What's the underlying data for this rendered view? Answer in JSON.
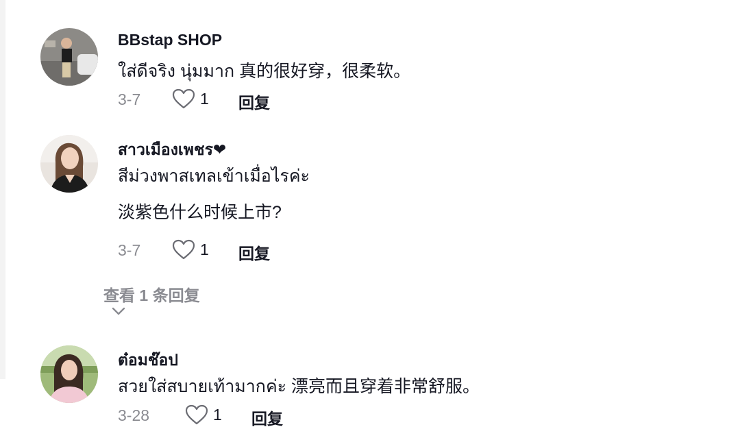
{
  "comments": [
    {
      "username": "BBstap SHOP",
      "lines": [
        "ใส่ดีจริง นุ่มมาก 真的很好穿，很柔软。"
      ],
      "date": "3-7",
      "likes": "1",
      "reply_label": "回复"
    },
    {
      "username": "สาวเมืองเพชร❤",
      "lines": [
        "สีม่วงพาสเทลเข้าเมื่อไรค่ะ",
        "淡紫色什么时候上市?"
      ],
      "date": "3-7",
      "likes": "1",
      "reply_label": "回复",
      "view_replies": "查看 1 条回复"
    },
    {
      "username": "ต๋อมช๊อป",
      "lines": [
        "สวยใส่สบายเท้ามากค่ะ 漂亮而且穿着非常舒服。"
      ],
      "date": "3-28",
      "likes": "1",
      "reply_label": "回复"
    }
  ],
  "colors": {
    "text_primary": "#161823",
    "text_secondary": "#8a8b91",
    "background": "#ffffff"
  },
  "icons": {
    "like": "heart-outline-icon",
    "expand": "chevron-down-icon"
  }
}
